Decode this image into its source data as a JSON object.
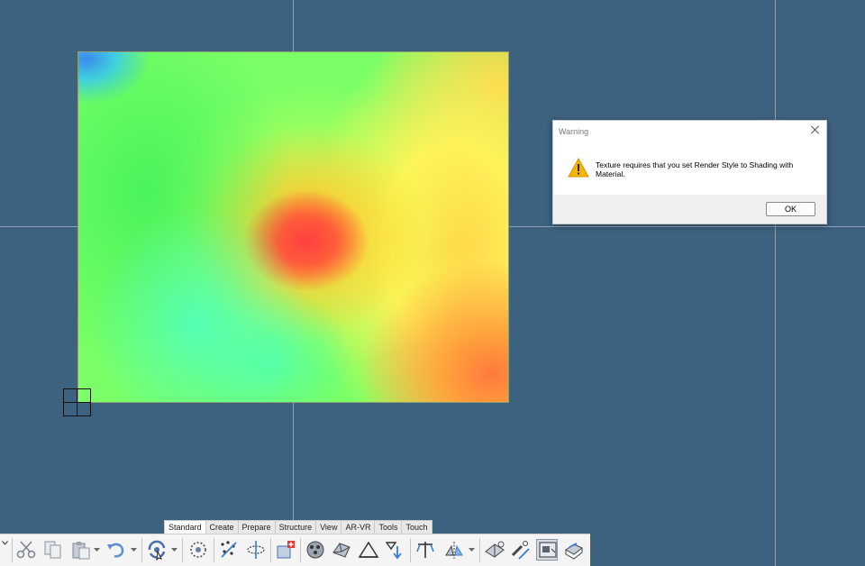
{
  "dialog": {
    "title": "Warning",
    "message": "Texture requires that you set Render Style to Shading with Material.",
    "ok_label": "OK"
  },
  "ribbon_tabs": [
    "Standard",
    "Create",
    "Prepare",
    "Structure",
    "View",
    "AR-VR",
    "Tools",
    "Touch"
  ],
  "active_tab": "Standard",
  "toolbar_icons": [
    "toolbar-menu-chevron-icon",
    "cut-icon",
    "copy-icon",
    "paste-icon",
    "undo-icon",
    "orbit-icon",
    "snap-icon",
    "scatter-icon",
    "section-icon",
    "add-structure-icon",
    "mesh-icon",
    "shape-icon",
    "terrain-icon",
    "filter-icon",
    "transform-icon",
    "mirror-icon",
    "render-icon",
    "measure-icon",
    "viewport-icon",
    "print-icon"
  ],
  "colors": {
    "background": "#3d6280",
    "warning": "#f5b400",
    "heat_low": "#3a7dff",
    "heat_mid": "#7aff66",
    "heat_high": "#ff4040"
  }
}
